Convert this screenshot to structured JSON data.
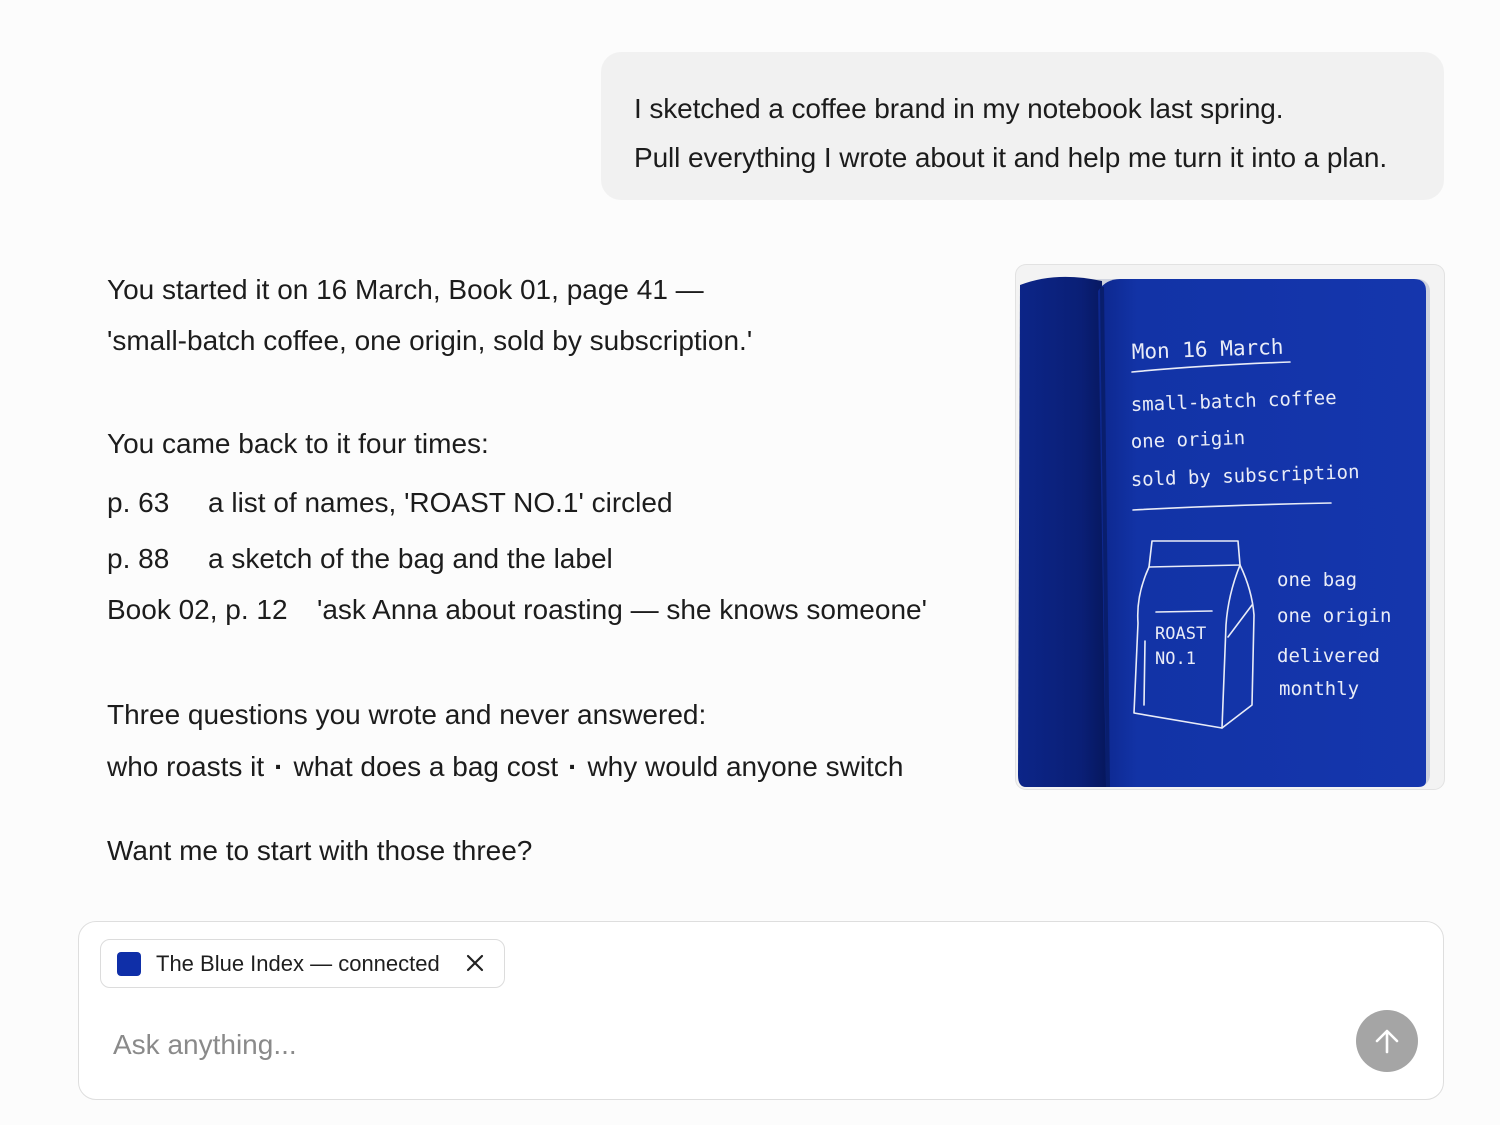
{
  "conversation": {
    "user_message": {
      "lines": [
        "I sketched a coffee brand in my notebook last spring.",
        "Pull everything I wrote about it and help me turn it into a plan."
      ]
    },
    "assistant_message": {
      "intro_line_1": "You started it on 16 March, Book 01, page 41 —",
      "intro_line_2": "'small-batch coffee, one origin, sold by subscription.'",
      "revisits_heading": "You came back to it four times:",
      "mentions": [
        {
          "page": "p. 63",
          "note": "a list of names, 'ROAST NO.1' circled"
        },
        {
          "page": "p. 88",
          "note": "a sketch of the bag and the label"
        },
        {
          "page": "Book 02, p. 12",
          "note": "'ask Anna about roasting — she knows someone'"
        }
      ],
      "questions_heading": "Three questions you wrote and never answered:",
      "questions": [
        "who roasts it",
        "what does a bag cost",
        "why would anyone switch"
      ],
      "question_separator": "·",
      "closing": "Want me to start with those three?"
    },
    "notebook_image": {
      "page_color": "#1233a6",
      "ink_color": "#e9ecf7",
      "date": "Mon 16 March",
      "notes": [
        "small-batch coffee",
        "one origin",
        "sold by subscription"
      ],
      "bag_label": [
        "ROAST",
        "NO.1"
      ],
      "side_notes": [
        "one bag",
        "one origin",
        "delivered",
        "monthly"
      ]
    }
  },
  "composer": {
    "connector_chip": {
      "label": "The Blue Index — connected",
      "swatch_color": "#0f2fa8",
      "close_icon": "close-icon"
    },
    "input": {
      "placeholder": "Ask anything...",
      "value": ""
    },
    "send_icon": "arrow-up-icon"
  }
}
